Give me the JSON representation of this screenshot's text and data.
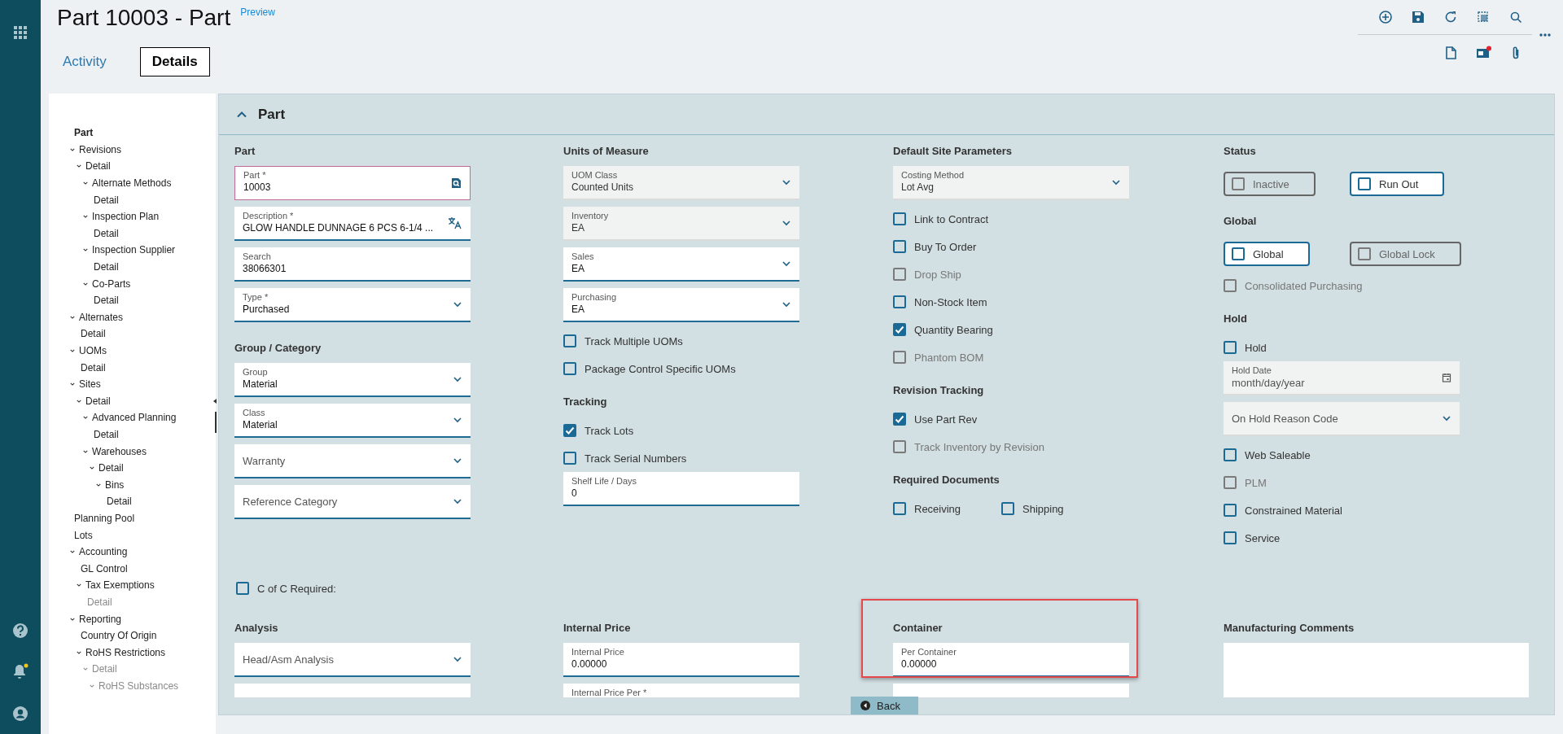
{
  "rail": {
    "notification": true
  },
  "page": {
    "title": "Part 10003 - Part",
    "preview_link": "Preview"
  },
  "tabs": [
    {
      "label": "Activity",
      "selected": false
    },
    {
      "label": "Details",
      "selected": true
    }
  ],
  "toolbar": {
    "alert": true
  },
  "tree": [
    {
      "label": "Part",
      "selected": true,
      "disabled": false
    },
    {
      "label": "Revisions",
      "selected": false,
      "disabled": false,
      "expanded": true,
      "children": [
        {
          "label": "Detail",
          "selected": false,
          "disabled": false,
          "expanded": true,
          "children": [
            {
              "label": "Alternate Methods",
              "selected": false,
              "disabled": false,
              "expanded": true,
              "children": [
                {
                  "label": "Detail",
                  "selected": false,
                  "disabled": false
                }
              ]
            },
            {
              "label": "Inspection Plan",
              "selected": false,
              "disabled": false,
              "expanded": true,
              "children": [
                {
                  "label": "Detail",
                  "selected": false,
                  "disabled": false
                }
              ]
            },
            {
              "label": "Inspection Supplier",
              "selected": false,
              "disabled": false,
              "expanded": true,
              "children": [
                {
                  "label": "Detail",
                  "selected": false,
                  "disabled": false
                }
              ]
            },
            {
              "label": "Co-Parts",
              "selected": false,
              "disabled": false,
              "expanded": true,
              "children": [
                {
                  "label": "Detail",
                  "selected": false,
                  "disabled": false
                }
              ]
            }
          ]
        }
      ]
    },
    {
      "label": "Alternates",
      "selected": false,
      "disabled": false,
      "expanded": true,
      "children": [
        {
          "label": "Detail",
          "selected": false,
          "disabled": false
        }
      ]
    },
    {
      "label": "UOMs",
      "selected": false,
      "disabled": false,
      "expanded": true,
      "children": [
        {
          "label": "Detail",
          "selected": false,
          "disabled": false
        }
      ]
    },
    {
      "label": "Sites",
      "selected": false,
      "disabled": false,
      "expanded": true,
      "children": [
        {
          "label": "Detail",
          "selected": false,
          "disabled": false,
          "expanded": true,
          "children": [
            {
              "label": "Advanced Planning",
              "selected": false,
              "disabled": false,
              "expanded": true,
              "children": [
                {
                  "label": "Detail",
                  "selected": false,
                  "disabled": false
                }
              ]
            },
            {
              "label": "Warehouses",
              "selected": false,
              "disabled": false,
              "expanded": true,
              "children": [
                {
                  "label": "Detail",
                  "selected": false,
                  "disabled": false,
                  "expanded": true,
                  "children": [
                    {
                      "label": "Bins",
                      "selected": false,
                      "disabled": false,
                      "expanded": true,
                      "children": [
                        {
                          "label": "Detail",
                          "selected": false,
                          "disabled": false
                        }
                      ]
                    }
                  ]
                }
              ]
            }
          ]
        }
      ]
    },
    {
      "label": "Planning Pool",
      "selected": false,
      "disabled": false
    },
    {
      "label": "Lots",
      "selected": false,
      "disabled": false
    },
    {
      "label": "Accounting",
      "selected": false,
      "disabled": false,
      "expanded": true,
      "children": [
        {
          "label": "GL Control",
          "selected": false,
          "disabled": false
        },
        {
          "label": "Tax Exemptions",
          "selected": false,
          "disabled": false,
          "expanded": true,
          "children": [
            {
              "label": "Detail",
              "selected": false,
              "disabled": true
            }
          ]
        }
      ]
    },
    {
      "label": "Reporting",
      "selected": false,
      "disabled": false,
      "expanded": true,
      "children": [
        {
          "label": "Country Of Origin",
          "selected": false,
          "disabled": false
        },
        {
          "label": "RoHS Restrictions",
          "selected": false,
          "disabled": false,
          "expanded": true,
          "children": [
            {
              "label": "Detail",
              "selected": false,
              "disabled": true,
              "expanded": true,
              "children": [
                {
                  "label": "RoHS Substances",
                  "selected": false,
                  "disabled": true,
                  "expanded": true
                }
              ]
            }
          ]
        }
      ]
    }
  ],
  "panel": {
    "title": "Part",
    "expanded": true,
    "columns": [
      {
        "items": [
          {
            "kind": "heading",
            "text": "Part"
          },
          {
            "kind": "lookup",
            "label": "Part *",
            "value": "10003",
            "disabled": false,
            "focused": true
          },
          {
            "kind": "translatable",
            "label": "Description *",
            "value": "GLOW HANDLE DUNNAGE 6 PCS 6-1/4 ...",
            "disabled": false,
            "focused": false
          },
          {
            "kind": "text",
            "label": "Search",
            "value": "38066301",
            "disabled": false,
            "focused": false
          },
          {
            "kind": "select",
            "label": "Type *",
            "value": "Purchased",
            "disabled": false,
            "focused": false
          },
          {
            "kind": "heading",
            "text": "Group / Category"
          },
          {
            "kind": "select",
            "label": "Group",
            "value": "Material",
            "disabled": false,
            "focused": false
          },
          {
            "kind": "select",
            "label": "Class",
            "value": "Material",
            "disabled": false,
            "focused": false
          },
          {
            "kind": "select",
            "placeholder": "Warranty",
            "disabled": false,
            "focused": false
          },
          {
            "kind": "select",
            "placeholder": "Reference Category",
            "disabled": false,
            "focused": false
          }
        ]
      },
      {
        "items": [
          {
            "kind": "heading",
            "text": "Units of Measure"
          },
          {
            "kind": "select",
            "label": "UOM Class",
            "value": "Counted Units",
            "disabled": true,
            "focused": false
          },
          {
            "kind": "select",
            "label": "Inventory",
            "value": "EA",
            "disabled": true,
            "focused": false
          },
          {
            "kind": "select",
            "label": "Sales",
            "value": "EA",
            "disabled": false,
            "focused": false
          },
          {
            "kind": "select",
            "label": "Purchasing",
            "value": "EA",
            "disabled": false,
            "focused": false
          },
          {
            "kind": "checkbox",
            "label": "Track Multiple UOMs",
            "checked": false,
            "disabled": false
          },
          {
            "kind": "checkbox",
            "label": "Package Control Specific UOMs",
            "checked": false,
            "disabled": false
          },
          {
            "kind": "heading",
            "text": "Tracking"
          },
          {
            "kind": "checkbox",
            "label": "Track Lots",
            "checked": true,
            "disabled": false
          },
          {
            "kind": "checkbox",
            "label": "Track Serial Numbers",
            "checked": false,
            "disabled": false
          },
          {
            "kind": "text",
            "label": "Shelf Life / Days",
            "value": "0",
            "disabled": false,
            "focused": false
          }
        ]
      },
      {
        "items": [
          {
            "kind": "heading",
            "text": "Default Site Parameters"
          },
          {
            "kind": "select",
            "label": "Costing Method",
            "value": "Lot Avg",
            "disabled": true,
            "focused": false
          },
          {
            "kind": "checkbox",
            "label": "Link to Contract",
            "checked": false,
            "disabled": false
          },
          {
            "kind": "checkbox",
            "label": "Buy To Order",
            "checked": false,
            "disabled": false
          },
          {
            "kind": "checkbox",
            "label": "Drop Ship",
            "checked": false,
            "disabled": true
          },
          {
            "kind": "checkbox",
            "label": "Non-Stock Item",
            "checked": false,
            "disabled": false
          },
          {
            "kind": "checkbox",
            "label": "Quantity Bearing",
            "checked": true,
            "disabled": false
          },
          {
            "kind": "checkbox",
            "label": "Phantom BOM",
            "checked": false,
            "disabled": true
          },
          {
            "kind": "heading",
            "text": "Revision Tracking"
          },
          {
            "kind": "checkbox",
            "label": "Use Part Rev",
            "checked": true,
            "disabled": false
          },
          {
            "kind": "checkbox",
            "label": "Track Inventory by Revision",
            "checked": false,
            "disabled": true
          },
          {
            "kind": "heading",
            "text": "Required Documents"
          },
          {
            "kind": "checkrow",
            "items": [
              {
                "label": "Receiving",
                "checked": false,
                "disabled": false
              },
              {
                "label": "Shipping",
                "checked": false,
                "disabled": false
              }
            ]
          }
        ]
      },
      {
        "items": [
          {
            "kind": "heading",
            "text": "Status"
          },
          {
            "kind": "boxrow",
            "items": [
              {
                "label": "Inactive",
                "checked": false,
                "disabled": true
              },
              {
                "label": "Run Out",
                "checked": false,
                "disabled": false
              }
            ]
          },
          {
            "kind": "heading",
            "text": "Global"
          },
          {
            "kind": "boxrow",
            "items": [
              {
                "label": "Global",
                "checked": false,
                "disabled": false
              },
              {
                "label": "Global Lock",
                "checked": false,
                "disabled": true
              }
            ]
          },
          {
            "kind": "checkbox",
            "label": "Consolidated Purchasing",
            "checked": false,
            "disabled": true
          },
          {
            "kind": "heading",
            "text": "Hold"
          },
          {
            "kind": "checkbox",
            "label": "Hold",
            "checked": false,
            "disabled": false
          },
          {
            "kind": "date",
            "label": "Hold Date",
            "placeholder": "month/day/year",
            "disabled": true,
            "focused": false
          },
          {
            "kind": "select",
            "placeholder": "On Hold Reason Code",
            "disabled": true,
            "focused": false
          },
          {
            "kind": "checkbox",
            "label": "Web Saleable",
            "checked": false,
            "disabled": false
          },
          {
            "kind": "checkbox",
            "label": "PLM",
            "checked": false,
            "disabled": true
          },
          {
            "kind": "checkbox",
            "label": "Constrained Material",
            "checked": false,
            "disabled": false
          },
          {
            "kind": "checkbox",
            "label": "Service",
            "checked": false,
            "disabled": false
          }
        ]
      }
    ],
    "coc": {
      "label": "C of C Required:",
      "checked": false,
      "disabled": false
    },
    "lower_sections": [
      {
        "title": "Analysis",
        "highlighted": false,
        "fields": [
          {
            "kind": "select",
            "placeholder": "Head/Asm Analysis",
            "disabled": false,
            "focused": false
          },
          {
            "kind": "text",
            "disabled": false,
            "focused": false
          }
        ]
      },
      {
        "title": "Internal Price",
        "highlighted": false,
        "fields": [
          {
            "kind": "text",
            "label": "Internal Price",
            "value": "0.00000",
            "disabled": false,
            "focused": false
          },
          {
            "kind": "text",
            "label": "Internal Price Per *",
            "disabled": false,
            "focused": false
          }
        ]
      },
      {
        "title": "Container",
        "highlighted": true,
        "fields": [
          {
            "kind": "text",
            "label": "Per Container",
            "value": "0.00000",
            "disabled": false,
            "focused": false
          },
          {
            "kind": "text",
            "disabled": false,
            "focused": false
          }
        ]
      },
      {
        "title": "Manufacturing Comments",
        "highlighted": false,
        "fields": [
          {
            "kind": "textarea",
            "disabled": false,
            "focused": false
          }
        ]
      }
    ],
    "back_button": {
      "label": "Back"
    }
  }
}
